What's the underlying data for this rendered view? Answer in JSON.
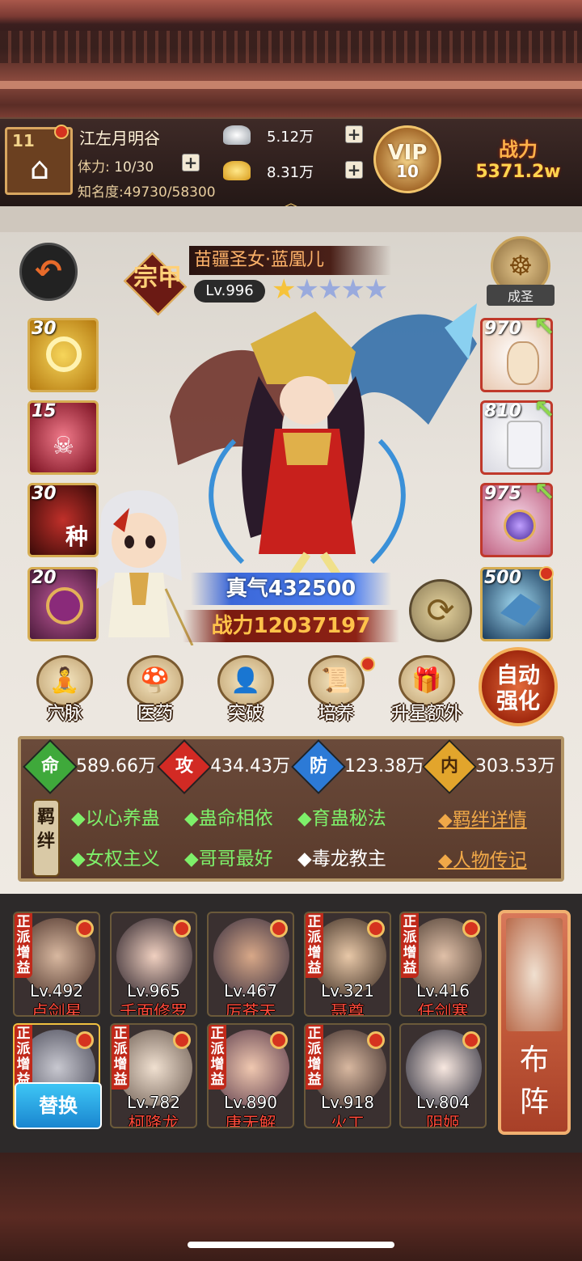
{
  "player": {
    "level": "11",
    "name": "江左月明谷",
    "stamina_label": "体力:",
    "stamina": "10/30",
    "fame_label": "知名度:",
    "fame": "49730/58300"
  },
  "currency": {
    "silver": "5.12万",
    "gold": "8.31万"
  },
  "vip": {
    "label": "VIP",
    "level": "10"
  },
  "power_top": {
    "label": "战力",
    "value": "5371.2w"
  },
  "hero": {
    "grade": "宗甲",
    "title": "苗疆圣女·蓝凰儿",
    "level": "Lv.996",
    "stars_gold": 1,
    "stars_total": 5,
    "rank_label": "成圣",
    "zhenqi": "真气432500",
    "power": "战力12037197"
  },
  "skills": [
    {
      "level": "30",
      "icon": "gold-swirl-icon"
    },
    {
      "level": "15",
      "icon": "skull-icon"
    },
    {
      "level": "30",
      "icon": "seed-icon",
      "char": "种"
    },
    {
      "level": "20",
      "icon": "orb-icon"
    }
  ],
  "equips": [
    {
      "level": "970",
      "icon": "gourd-icon"
    },
    {
      "level": "810",
      "icon": "robe-icon"
    },
    {
      "level": "975",
      "icon": "lantern-icon"
    },
    {
      "level": "500",
      "icon": "phoenix-icon"
    }
  ],
  "actions": [
    {
      "label": "穴脉",
      "icon": "meridian-icon"
    },
    {
      "label": "医药",
      "icon": "herb-icon"
    },
    {
      "label": "突破",
      "icon": "breakthrough-icon"
    },
    {
      "label": "培养",
      "icon": "scroll-icon"
    },
    {
      "label": "升星额外",
      "icon": "treasure-icon"
    }
  ],
  "auto_label_1": "自动",
  "auto_label_2": "强化",
  "stats": [
    {
      "char": "命",
      "value": "589.66万",
      "color": "#3fa93b"
    },
    {
      "char": "攻",
      "value": "434.43万",
      "color": "#d22a24"
    },
    {
      "char": "防",
      "value": "123.38万",
      "color": "#2c7ad6"
    },
    {
      "char": "内",
      "value": "303.53万",
      "color": "#e2a52c"
    }
  ],
  "bond_tag": "羁绊",
  "bonds": [
    {
      "text": "◆以心养蛊",
      "active": true
    },
    {
      "text": "◆蛊命相依",
      "active": true
    },
    {
      "text": "◆育蛊秘法",
      "active": true
    },
    {
      "text": "◆女权主义",
      "active": true
    },
    {
      "text": "◆哥哥最好",
      "active": true
    },
    {
      "text": "◆毒龙教主",
      "active": false
    }
  ],
  "links": {
    "bond_detail": "◆羁绊详情",
    "biography": "◆人物传记"
  },
  "tag_text": "正派增益",
  "team": [
    {
      "level": "Lv.492",
      "name": "卢剑星",
      "tag": true
    },
    {
      "level": "Lv.965",
      "name": "千面修罗",
      "tag": false
    },
    {
      "level": "Lv.467",
      "name": "厉苍天",
      "tag": false
    },
    {
      "level": "Lv.321",
      "name": "聂尊",
      "tag": true
    },
    {
      "level": "Lv.416",
      "name": "任剑寒",
      "tag": true
    },
    {
      "level": "",
      "name": "",
      "tag": true
    },
    {
      "level": "Lv.782",
      "name": "柯降龙",
      "tag": true
    },
    {
      "level": "Lv.890",
      "name": "唐无解",
      "tag": true
    },
    {
      "level": "Lv.918",
      "name": "火工",
      "tag": true
    },
    {
      "level": "Lv.804",
      "name": "阴姬",
      "tag": false
    }
  ],
  "swap_label": "替换",
  "formation_label_1": "布",
  "formation_label_2": "阵"
}
